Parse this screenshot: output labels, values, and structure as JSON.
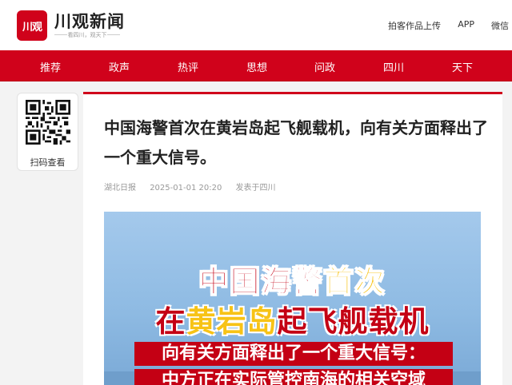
{
  "header": {
    "logo_mark": "川观",
    "logo_title": "川观新闻",
    "logo_slogan": "看四川，观天下",
    "links": [
      "拍客作品上传",
      "APP",
      "微信"
    ]
  },
  "nav": {
    "items": [
      "推荐",
      "政声",
      "热评",
      "思想",
      "问政",
      "四川",
      "天下"
    ]
  },
  "qr": {
    "label": "扫码查看",
    "icon": "qr-code-icon"
  },
  "article": {
    "title": "中国海警首次在黄岩岛起飞舰载机，向有关方面释出了一个重大信号。",
    "source": "湖北日报",
    "datetime": "2025-01-01 20:20",
    "location": "发表于四川",
    "image": {
      "line1_a": "中国海警",
      "line1_b": "首次",
      "line2_a": "在",
      "line2_b": "黄岩岛",
      "line2_c": "起飞舰载机",
      "band1": "向有关方面释出了一个重大信号：",
      "band2": "中方正在实际管控南海的相关空域"
    }
  },
  "colors": {
    "brand_red": "#d0021b",
    "highlight_yellow": "#f7c316"
  }
}
